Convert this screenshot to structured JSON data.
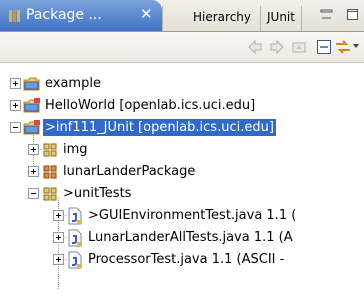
{
  "tabs": {
    "active_label": "Package ...",
    "close_glyph": "✕",
    "hierarchy_label": "Hierarchy",
    "junit_label": "JUnit"
  },
  "toolbar": {
    "icons": [
      "back-arrow-icon",
      "forward-arrow-icon",
      "up-folder-icon",
      "collapse-all-icon",
      "link-with-editor-icon",
      "view-menu-icon"
    ]
  },
  "tree": {
    "rows": [
      {
        "label": "example",
        "icon": "project-folder-icon"
      },
      {
        "label": "HelloWorld  [openlab.ics.uci.edu]",
        "icon": "cvs-project-icon"
      },
      {
        "label": ">inf111_JUnit  [openlab.ics.uci.edu]",
        "icon": "cvs-project-icon",
        "selected": true
      },
      {
        "label": "img",
        "icon": "package-icon"
      },
      {
        "label": "lunarLanderPackage",
        "icon": "package-icon"
      },
      {
        "label": ">unitTests",
        "icon": "package-icon"
      },
      {
        "label": ">GUIEnvironmentTest.java 1.1  (",
        "icon": "java-file-icon"
      },
      {
        "label": "LunarLanderAllTests.java 1.1  (A",
        "icon": "java-file-icon"
      },
      {
        "label": "ProcessorTest.java 1.1  (ASCII -",
        "icon": "java-file-icon"
      }
    ]
  },
  "colors": {
    "selection": "#316ac5",
    "active_tab": "#4a7bc8"
  }
}
